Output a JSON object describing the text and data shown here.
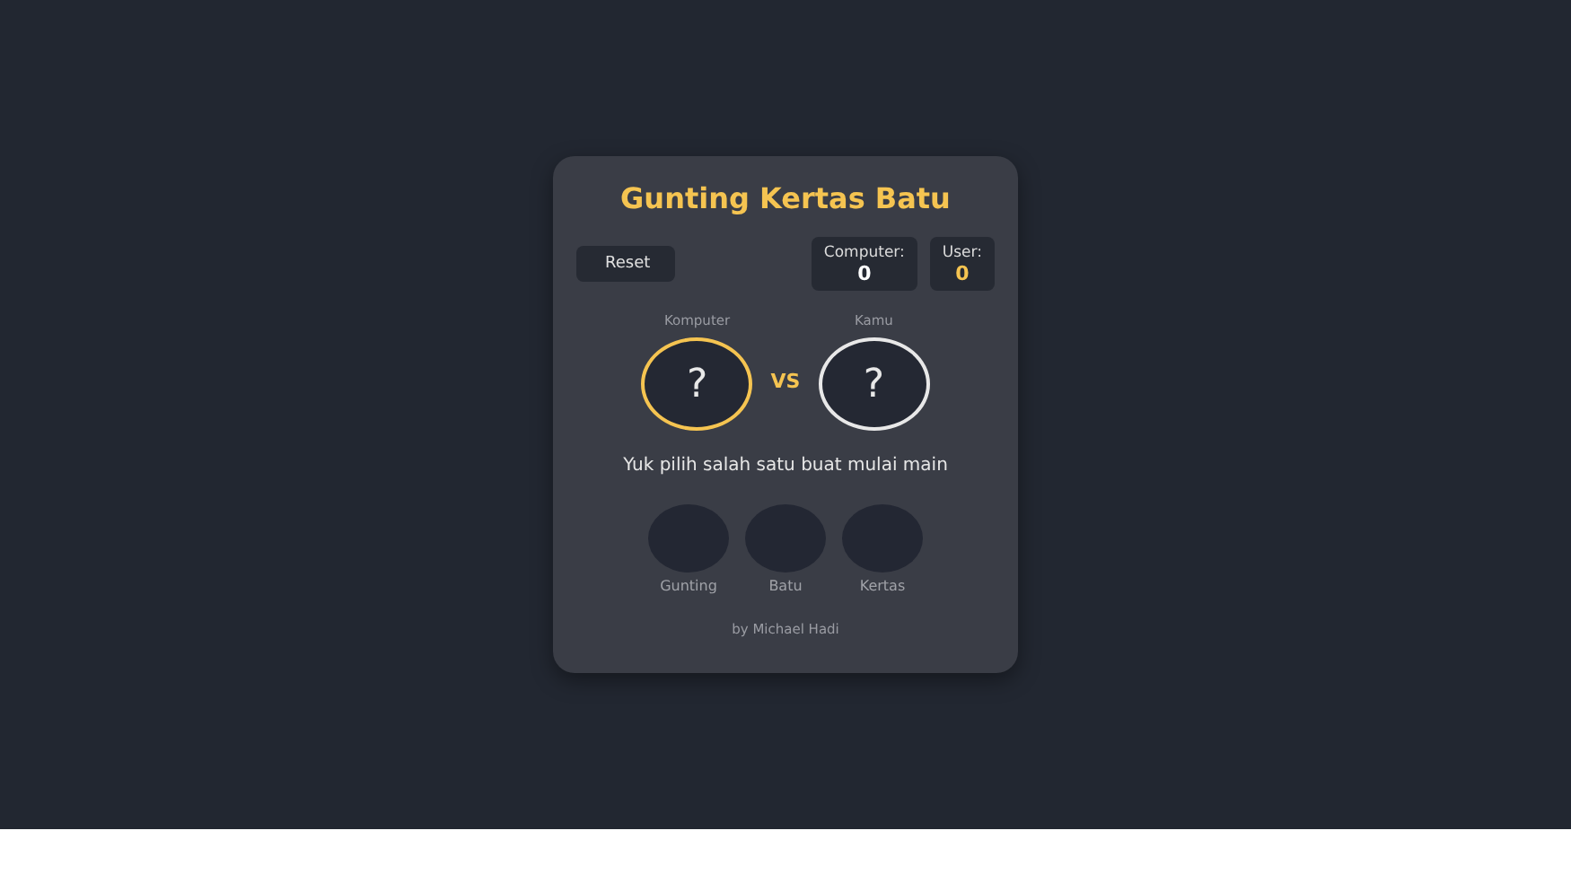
{
  "title": "Gunting Kertas Batu",
  "reset_button": "Reset",
  "scores": [
    {
      "label": "Computer:",
      "value": "0",
      "color": "#ffffff"
    },
    {
      "label": "User:",
      "value": "0",
      "color": "#f5c451"
    }
  ],
  "players": [
    {
      "label": "Komputer",
      "choice": "?",
      "color": "#f5c451"
    },
    {
      "label": "Kamu",
      "choice": "?",
      "color": "#e8e8e8"
    }
  ],
  "vs": "VS",
  "message": "Yuk pilih salah satu buat mulai main",
  "options": [
    {
      "label": "Gunting"
    },
    {
      "label": "Batu"
    },
    {
      "label": "Kertas"
    }
  ],
  "footer": "by Michael Hadi"
}
